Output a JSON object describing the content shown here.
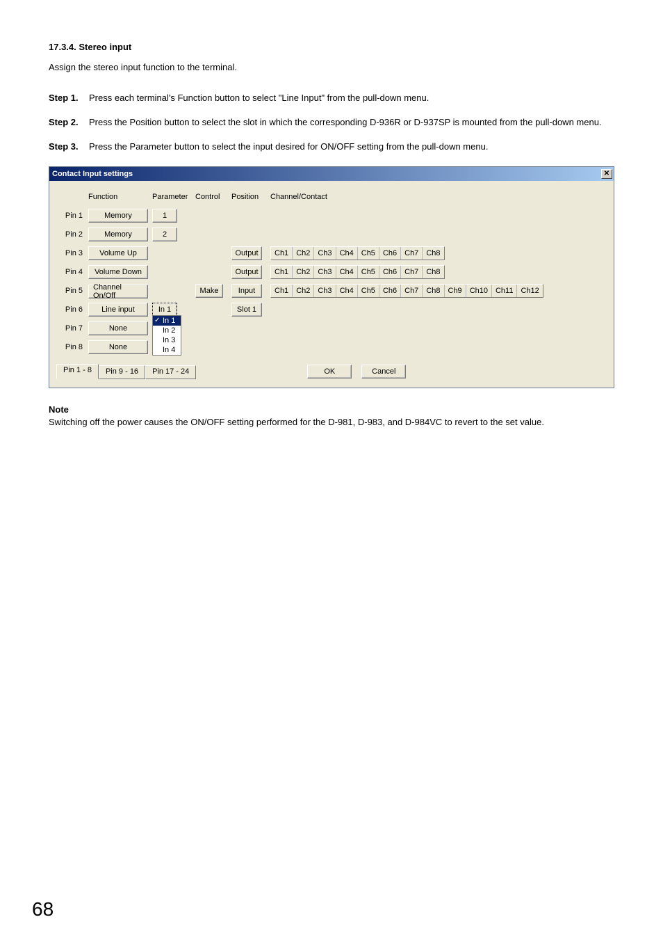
{
  "section": {
    "number": "17.3.4.",
    "title": "Stereo input"
  },
  "intro": "Assign the stereo input function to the terminal.",
  "steps": [
    {
      "label": "Step 1.",
      "text": "Press each terminal's Function button to select \"Line Input\" from the pull-down menu."
    },
    {
      "label": "Step 2.",
      "text": "Press the Position button to select the slot in which the corresponding D-936R or D-937SP is mounted from the pull-down menu."
    },
    {
      "label": "Step 3.",
      "text": "Press the Parameter button to select the input desired for ON/OFF setting from the pull-down menu."
    }
  ],
  "dialog": {
    "title": "Contact Input settings",
    "headers": {
      "function": "Function",
      "parameter": "Parameter",
      "control": "Control",
      "position": "Position",
      "channel": "Channel/Contact"
    },
    "rows": {
      "r1": {
        "pin": "Pin 1",
        "func": "Memory",
        "param": "1"
      },
      "r2": {
        "pin": "Pin 2",
        "func": "Memory",
        "param": "2"
      },
      "r3": {
        "pin": "Pin 3",
        "func": "Volume Up",
        "pos": "Output"
      },
      "r4": {
        "pin": "Pin 4",
        "func": "Volume Down",
        "pos": "Output"
      },
      "r5": {
        "pin": "Pin 5",
        "func": "Channel On/Off",
        "ctrl": "Make",
        "pos": "Input"
      },
      "r6": {
        "pin": "Pin 6",
        "func": "Line input",
        "param": "In 1",
        "pos": "Slot 1"
      },
      "r7": {
        "pin": "Pin 7",
        "func": "None"
      },
      "r8": {
        "pin": "Pin 8",
        "func": "None"
      }
    },
    "ch8": [
      "Ch1",
      "Ch2",
      "Ch3",
      "Ch4",
      "Ch5",
      "Ch6",
      "Ch7",
      "Ch8"
    ],
    "ch12": [
      "Ch1",
      "Ch2",
      "Ch3",
      "Ch4",
      "Ch5",
      "Ch6",
      "Ch7",
      "Ch8",
      "Ch9",
      "Ch10",
      "Ch11",
      "Ch12"
    ],
    "dropdown": {
      "items": [
        "In 1",
        "In 2",
        "In 3",
        "In 4"
      ],
      "selected": "In 1"
    },
    "pin_tabs": [
      "Pin 1 - 8",
      "Pin 9 - 16",
      "Pin 17 - 24"
    ],
    "ok": "OK",
    "cancel": "Cancel"
  },
  "note": {
    "head": "Note",
    "body": "Switching off the power causes the ON/OFF setting performed for the D-981, D-983, and D-984VC to revert to the set value."
  },
  "page_number": "68"
}
